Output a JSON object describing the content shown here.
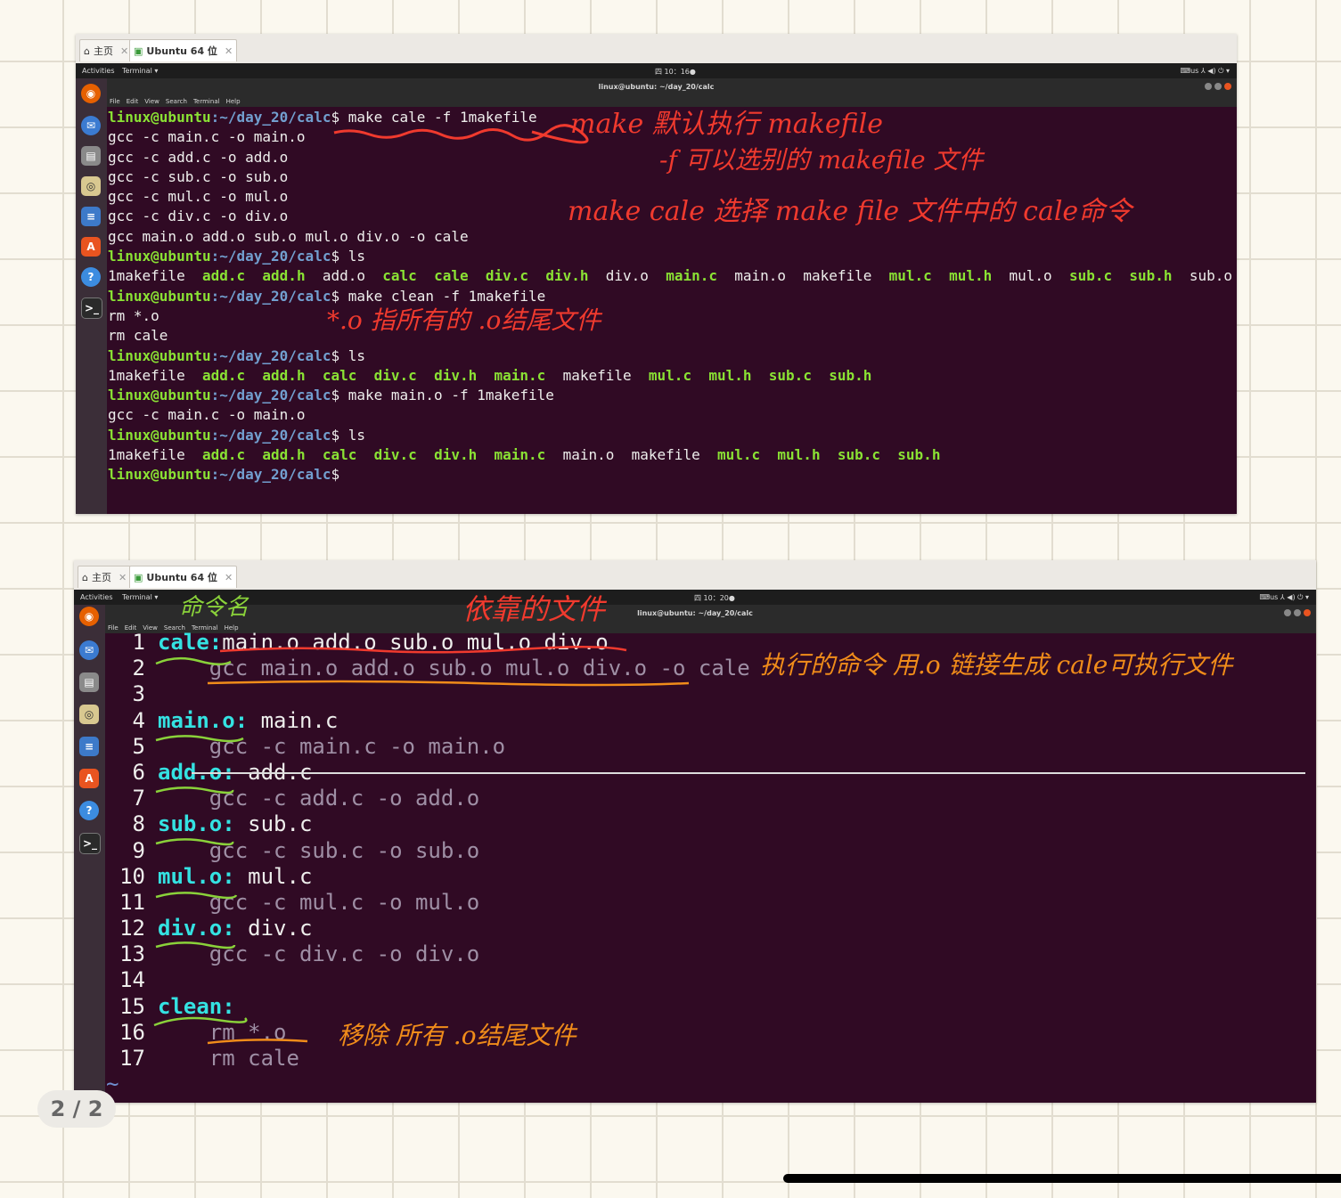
{
  "shot1": {
    "vm_tabs": [
      {
        "label": "主页"
      },
      {
        "label": "Ubuntu 64 位"
      }
    ],
    "topbar": {
      "activities": "Activities",
      "app": "Terminal ▾",
      "clock": "四 10：16●",
      "right": "⌨us   ⅄ ◀) ⏻ ▾"
    },
    "window_title": "linux@ubuntu: ~/day_20/calc",
    "menu": [
      "File",
      "Edit",
      "View",
      "Search",
      "Terminal",
      "Help"
    ],
    "prompt_user": "linux@ubuntu",
    "prompt_path": ":~/day_20/calc",
    "lines": [
      {
        "cmd": "$ make cale -f 1makefile"
      },
      {
        "text": "gcc -c main.c -o main.o"
      },
      {
        "text": "gcc -c add.c -o add.o"
      },
      {
        "text": "gcc -c sub.c -o sub.o"
      },
      {
        "text": "gcc -c mul.c -o mul.o"
      },
      {
        "text": "gcc -c div.c -o div.o"
      },
      {
        "text": "gcc main.o add.o sub.o mul.o div.o -o cale"
      },
      {
        "cmd": "$ ls"
      },
      {
        "ls": "1makefile  add.c  add.h  add.o  calc  cale  div.c  div.h  div.o  main.c  main.o  makefile  mul.c  mul.h  mul.o  sub.c  sub.h  sub.o"
      },
      {
        "cmd": "$ make clean -f 1makefile"
      },
      {
        "text": "rm *.o"
      },
      {
        "text": "rm cale"
      },
      {
        "cmd": "$ ls"
      },
      {
        "ls": "1makefile  add.c  add.h  calc  div.c  div.h  main.c  makefile  mul.c  mul.h  sub.c  sub.h"
      },
      {
        "cmd": "$ make main.o -f 1makefile"
      },
      {
        "text": "gcc -c main.c -o main.o"
      },
      {
        "cmd": "$ ls"
      },
      {
        "ls": "1makefile  add.c  add.h  calc  div.c  div.h  main.c  main.o  makefile  mul.c  mul.h  sub.c  sub.h"
      },
      {
        "cmd": "$"
      }
    ],
    "annotations": {
      "a1": "make 默认执行 makefile",
      "a2": "-f 可以选别的 makefile 文件",
      "a3": "make  cale 选择 make file  文件中的 cale命令",
      "a4": "*.o 指所有的 .o结尾文件"
    }
  },
  "shot2": {
    "vm_tabs": [
      {
        "label": "主页"
      },
      {
        "label": "Ubuntu 64 位"
      }
    ],
    "topbar": {
      "activities": "Activities",
      "app": "Terminal ▾",
      "clock": "四 10：20●",
      "right": "⌨us   ⅄ ◀) ⏻ ▾"
    },
    "window_title": "linux@ubuntu: ~/day_20/calc",
    "menu": [
      "File",
      "Edit",
      "View",
      "Search",
      "Terminal",
      "Help"
    ],
    "code": [
      {
        "n": "1",
        "t": "cale:",
        "r": "main.o add.o sub.o mul.o div.o"
      },
      {
        "n": "2",
        "c": "    gcc main.o add.o sub.o mul.o div.o -o cale"
      },
      {
        "n": "3"
      },
      {
        "n": "4",
        "t": "main.o:",
        "r": " main.c"
      },
      {
        "n": "5",
        "c": "    gcc -c main.c -o main.o"
      },
      {
        "n": "6",
        "t": "add.o:",
        "r": " add.c"
      },
      {
        "n": "7",
        "c": "    gcc -c add.c -o add.o"
      },
      {
        "n": "8",
        "t": "sub.o:",
        "r": " sub.c"
      },
      {
        "n": "9",
        "c": "    gcc -c sub.c -o sub.o"
      },
      {
        "n": "10",
        "t": "mul.o:",
        "r": " mul.c"
      },
      {
        "n": "11",
        "c": "    gcc -c mul.c -o mul.o"
      },
      {
        "n": "12",
        "t": "div.o:",
        "r": " div.c"
      },
      {
        "n": "13",
        "c": "    gcc -c div.c -o div.o"
      },
      {
        "n": "14"
      },
      {
        "n": "15",
        "t": "clean:"
      },
      {
        "n": "16",
        "c": "    rm *.o"
      },
      {
        "n": "17",
        "c": "    rm cale"
      }
    ],
    "tilde": "~",
    "annotations": {
      "b1": "命令名",
      "b2": "依靠的文件",
      "b3": "执行的命令 用.o 链接生成 cale可执行文件",
      "b4": "移除 所有 .o结尾文件"
    }
  },
  "page_indicator": "2 / 2",
  "colors": {
    "terminal_bg": "#300a24",
    "prompt_green": "#8ae234",
    "path_blue": "#729fcf",
    "target_cyan": "#34e2e2",
    "anno_red": "#f03a2e",
    "anno_orange": "#f08c1a",
    "anno_green": "#8ad23a"
  }
}
